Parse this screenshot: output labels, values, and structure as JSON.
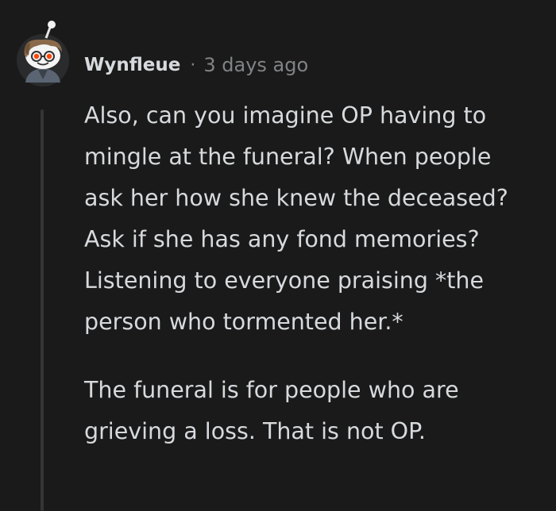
{
  "comment": {
    "username": "Wynfleue",
    "separator": "·",
    "timestamp": "3 days ago",
    "paragraphs": [
      "Also, can you imagine OP having to mingle at the funeral? When people ask her how she knew the deceased? Ask if she has any fond memories? Listening to everyone praising *the person who tormented her.*",
      "The funeral is for people who are grieving a loss. That is not OP."
    ]
  },
  "colors": {
    "background": "#1a1a1b",
    "text": "#d7dadc",
    "meta": "#818384",
    "thread_line": "#343536",
    "avatar_eyes": "#ff4500"
  },
  "icons": {
    "avatar": "snoo-avatar-icon"
  }
}
